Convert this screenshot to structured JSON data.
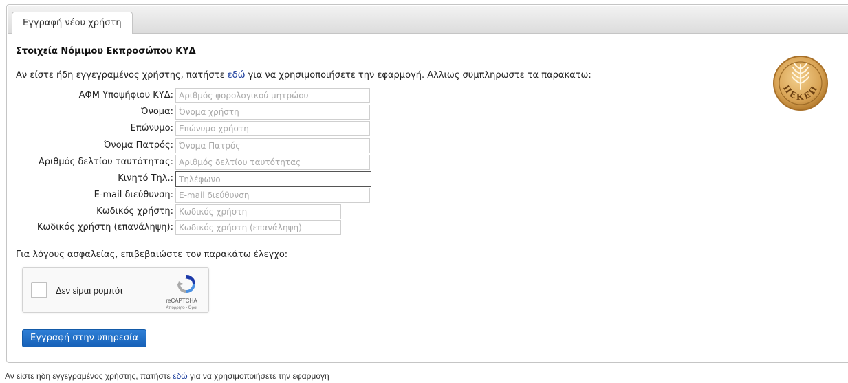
{
  "tab": {
    "label": "Εγγραφή νέου χρήστη"
  },
  "section": {
    "title": "Στοιχεία Νόμιμου Εκπροσώπου ΚΥΔ"
  },
  "intro": {
    "before": "Αν είστε ήδη εγγεγραμένος χρήστης, πατήστε ",
    "link": "εδώ",
    "after": " για να χρησιμοποιήσετε την εφαρμογή. Αλλιως συμπληρωστε τα παρακατω:"
  },
  "form": {
    "fields": [
      {
        "label": "ΑΦΜ Υποψήφιου ΚΥΔ:",
        "placeholder": "Αριθμός φορολογικού μητρώου",
        "value": ""
      },
      {
        "label": "Όνομα:",
        "placeholder": "Όνομα χρήστη",
        "value": ""
      },
      {
        "label": "Επώνυμο:",
        "placeholder": "Επώνυμο χρήστη",
        "value": ""
      },
      {
        "label": "Όνομα Πατρός:",
        "placeholder": "Όνομα Πατρός",
        "value": ""
      },
      {
        "label": "Αριθμός δελτίου ταυτότητας:",
        "placeholder": "Αριθμός δελτίου ταυτότητας",
        "value": ""
      },
      {
        "label": "Κινητό Τηλ.:",
        "placeholder": "Τηλέφωνο",
        "value": ""
      },
      {
        "label": "E-mail διεύθυνση:",
        "placeholder": "E-mail διεύθυνση",
        "value": ""
      },
      {
        "label": "Κωδικός χρήστη:",
        "placeholder": "Κωδικός χρήστη",
        "value": ""
      },
      {
        "label": "Κωδικός χρήστη (επανάληψη):",
        "placeholder": "Κωδικός χρήστη (επανάληψη)",
        "value": ""
      }
    ]
  },
  "security": {
    "note": "Για λόγους ασφαλείας, επιβεβαιώστε τον παρακάτω έλεγχο:"
  },
  "captcha": {
    "label": "Δεν είμαι ρομπότ",
    "brand": "reCAPTCHA",
    "terms": "Απόρρητο - Όροι",
    "icon": "recaptcha-icon"
  },
  "submit": {
    "label": "Εγγραφή στην υπηρεσία"
  },
  "logo": {
    "text": "ΟΠΕΚΕΠΕ",
    "icon": "opekepe-seal-icon"
  },
  "footer": {
    "before": "Αν είστε ήδη εγγεγραμένος χρήστης, πατήστε ",
    "link": "εδώ",
    "after": " για να χρησιμοποιήσετε την εφαρμογή"
  },
  "colors": {
    "link": "#1a3c9c",
    "button": "#1761b8",
    "logo_gold": "#d9a456",
    "tab_bar": "#dcdcdc"
  }
}
